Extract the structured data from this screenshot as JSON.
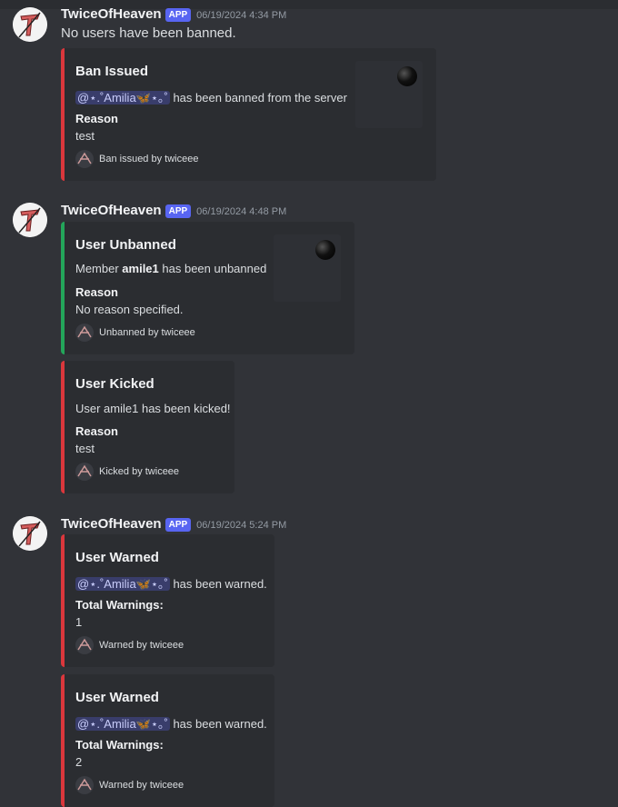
{
  "messages": [
    {
      "author": "TwiceOfHeaven",
      "badge": "APP",
      "timestamp": "06/19/2024 4:34 PM",
      "content": "No users have been banned.",
      "embed": {
        "title": "Ban Issued",
        "mention": "@⋆.˚Amilia🦋⋆｡˚",
        "desc_suffix": " has been banned from the server",
        "field_name": "Reason",
        "field_value": "test",
        "footer": "Ban issued by twiceee"
      }
    },
    {
      "author": "TwiceOfHeaven",
      "badge": "APP",
      "timestamp": "06/19/2024 4:48 PM",
      "embeds": [
        {
          "title": "User Unbanned",
          "desc_prefix": "Member ",
          "desc_bold": "amile1",
          "desc_suffix": " has been unbanned",
          "field_name": "Reason",
          "field_value": "No reason specified.",
          "footer": "Unbanned by twiceee"
        },
        {
          "title": "User Kicked",
          "desc": "User amile1 has been kicked!",
          "field_name": "Reason",
          "field_value": "test",
          "footer": "Kicked by twiceee"
        }
      ]
    },
    {
      "author": "TwiceOfHeaven",
      "badge": "APP",
      "timestamp": "06/19/2024 5:24 PM",
      "embeds": [
        {
          "title": "User Warned",
          "mention": "@⋆.˚Amilia🦋⋆｡˚",
          "desc_suffix": " has been warned.",
          "field_name": "Total Warnings:",
          "field_value": "1",
          "footer": "Warned by twiceee"
        },
        {
          "title": "User Warned",
          "mention": "@⋆.˚Amilia🦋⋆｡˚",
          "desc_suffix": " has been warned.",
          "field_name": "Total Warnings:",
          "field_value": "2",
          "footer": "Warned by twiceee"
        }
      ]
    }
  ],
  "colors": {
    "background": "#313338",
    "embed_bg": "#2b2d31",
    "red_bar": "#da373c",
    "green_bar": "#23a55a",
    "app_badge": "#5865f2"
  }
}
